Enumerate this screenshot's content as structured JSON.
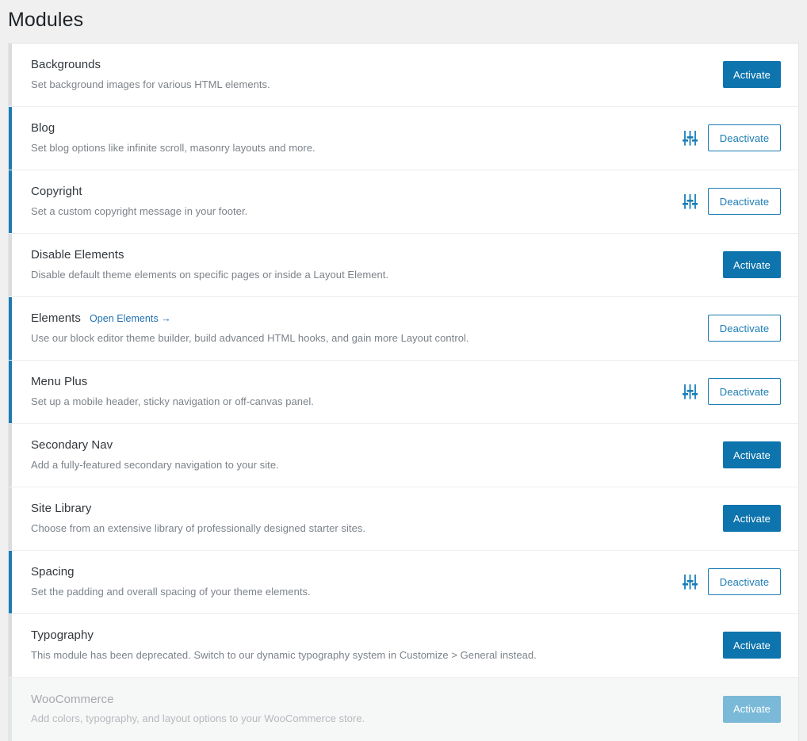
{
  "page": {
    "title": "Modules"
  },
  "labels": {
    "activate": "Activate",
    "deactivate": "Deactivate",
    "settings_icon": "sliders-settings-icon"
  },
  "colors": {
    "accent_blue": "#0d74ad",
    "outline_blue": "#1b7cb3",
    "link_blue": "#2271b1",
    "active_bar": "#1b7cb3",
    "inactive_bar": "#dcdcde",
    "disabled_button": "#7ab9d8",
    "page_background": "#f0f0f1",
    "row_background": "#ffffff",
    "disabled_row_background": "#f6f7f7",
    "title_text": "#32373c",
    "desc_text": "#7c8289"
  },
  "modules": [
    {
      "name": "Backgrounds",
      "description": "Set background images for various HTML elements.",
      "state": "inactive",
      "button": "Activate",
      "has_settings": false,
      "link": null
    },
    {
      "name": "Blog",
      "description": "Set blog options like infinite scroll, masonry layouts and more.",
      "state": "active",
      "button": "Deactivate",
      "has_settings": true,
      "link": null
    },
    {
      "name": "Copyright",
      "description": "Set a custom copyright message in your footer.",
      "state": "active",
      "button": "Deactivate",
      "has_settings": true,
      "link": null
    },
    {
      "name": "Disable Elements",
      "description": "Disable default theme elements on specific pages or inside a Layout Element.",
      "state": "inactive",
      "button": "Activate",
      "has_settings": false,
      "link": null
    },
    {
      "name": "Elements",
      "description": "Use our block editor theme builder, build advanced HTML hooks, and gain more Layout control.",
      "state": "active",
      "button": "Deactivate",
      "has_settings": false,
      "link": "Open Elements →"
    },
    {
      "name": "Menu Plus",
      "description": "Set up a mobile header, sticky navigation or off-canvas panel.",
      "state": "active",
      "button": "Deactivate",
      "has_settings": true,
      "link": null
    },
    {
      "name": "Secondary Nav",
      "description": "Add a fully-featured secondary navigation to your site.",
      "state": "inactive",
      "button": "Activate",
      "has_settings": false,
      "link": null
    },
    {
      "name": "Site Library",
      "description": "Choose from an extensive library of professionally designed starter sites.",
      "state": "inactive",
      "button": "Activate",
      "has_settings": false,
      "link": null
    },
    {
      "name": "Spacing",
      "description": "Set the padding and overall spacing of your theme elements.",
      "state": "active",
      "button": "Deactivate",
      "has_settings": true,
      "link": null
    },
    {
      "name": "Typography",
      "description": "This module has been deprecated. Switch to our dynamic typography system in Customize > General instead.",
      "state": "inactive",
      "button": "Activate",
      "has_settings": false,
      "link": null
    },
    {
      "name": "WooCommerce",
      "description": "Add colors, typography, and layout options to your WooCommerce store.",
      "state": "disabled",
      "button": "Activate",
      "has_settings": false,
      "link": null
    }
  ]
}
